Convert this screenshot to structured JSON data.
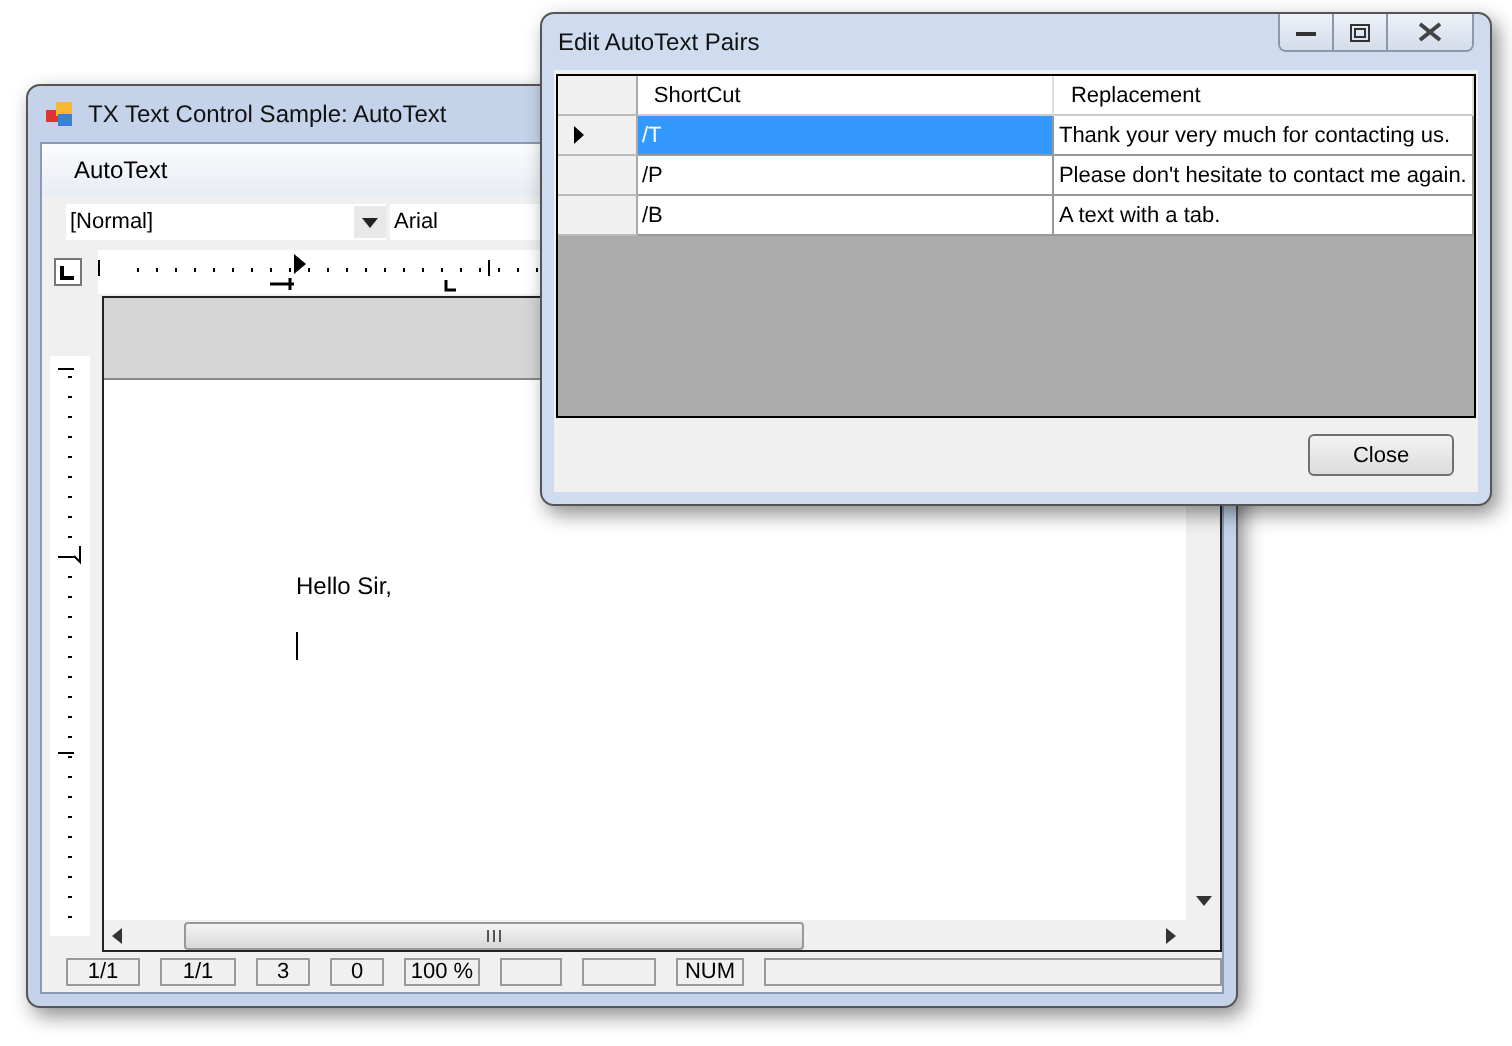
{
  "main_window": {
    "title": "TX Text Control Sample: AutoText",
    "menu": [
      "AutoText"
    ],
    "style_combo": {
      "value": "[Normal]"
    },
    "font_combo": {
      "value": "Arial"
    },
    "document": {
      "lines": [
        "Hello Sir,"
      ]
    },
    "status_bar": [
      {
        "kind": "text",
        "text": "1/1"
      },
      {
        "kind": "text",
        "text": "1/1"
      },
      {
        "kind": "text",
        "text": "3"
      },
      {
        "kind": "text",
        "text": "0"
      },
      {
        "kind": "text",
        "text": "100 %"
      },
      {
        "kind": "blank"
      },
      {
        "kind": "blank"
      },
      {
        "kind": "text",
        "text": "NUM"
      },
      {
        "kind": "blank"
      }
    ]
  },
  "dialog": {
    "title": "Edit AutoText Pairs",
    "columns": [
      "ShortCut",
      "Replacement"
    ],
    "rows": [
      {
        "shortcut": "/T",
        "replacement": "Thank your very much for contacting us.",
        "selected": true
      },
      {
        "shortcut": "/P",
        "replacement": "Please don't hesitate to contact me again.",
        "selected": false
      },
      {
        "shortcut": "/B",
        "replacement": "A text with a  tab.",
        "selected": false
      }
    ],
    "close_button": "Close"
  }
}
